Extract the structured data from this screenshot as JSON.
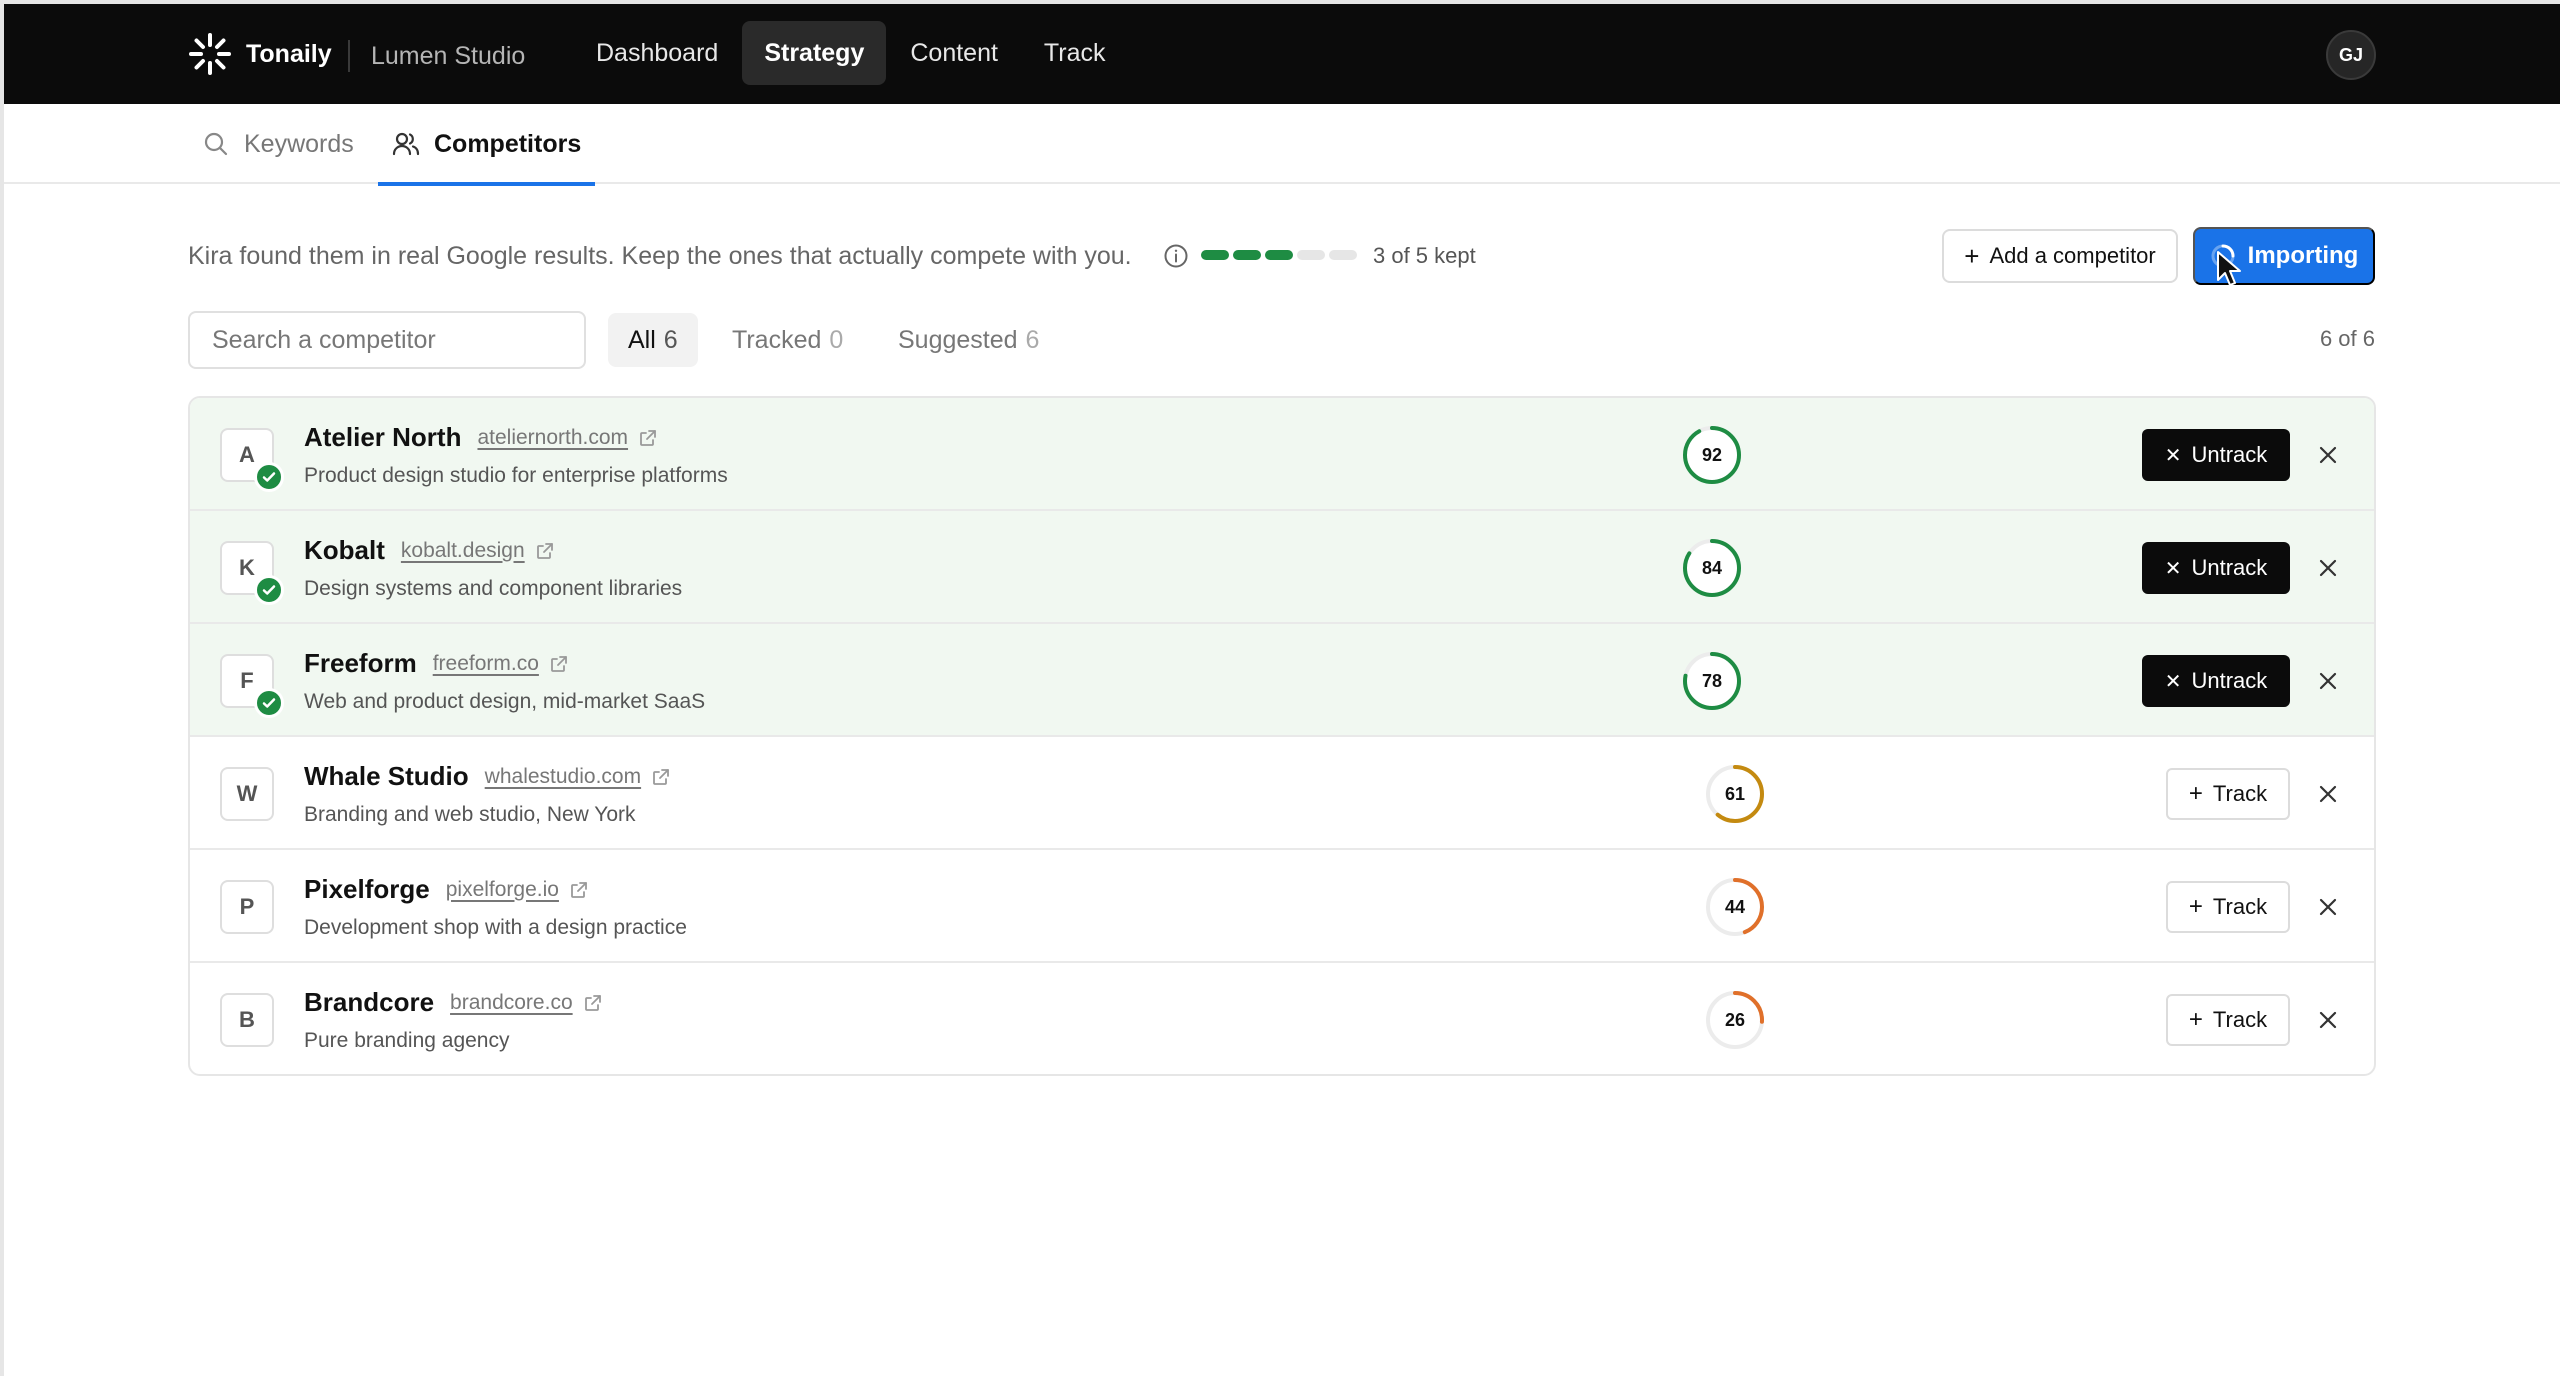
{
  "app": {
    "brand": "Tonaily",
    "workspace": "Lumen Studio",
    "avatar_initials": "GJ",
    "nav": [
      {
        "label": "Dashboard",
        "active": false
      },
      {
        "label": "Strategy",
        "active": true
      },
      {
        "label": "Content",
        "active": false
      },
      {
        "label": "Track",
        "active": false
      }
    ]
  },
  "subtabs": [
    {
      "label": "Keywords",
      "icon": "search-icon",
      "active": false
    },
    {
      "label": "Competitors",
      "icon": "users-icon",
      "active": true
    }
  ],
  "intro": {
    "text": "Kira found them in real Google results. Keep the ones that actually compete with you.",
    "kept_label": "3 of 5 kept",
    "kept": 3,
    "total": 5
  },
  "actions": {
    "add_label": "Add a competitor",
    "import_label": "Importing"
  },
  "filters": {
    "search_placeholder": "Search a competitor",
    "tabs": [
      {
        "label": "All",
        "count": "6",
        "active": true
      },
      {
        "label": "Tracked",
        "count": "0",
        "active": false
      },
      {
        "label": "Suggested",
        "count": "6",
        "active": false
      }
    ],
    "result_count": "6 of 6"
  },
  "labels": {
    "untrack": "Untrack",
    "track": "Track"
  },
  "colors": {
    "accent": "#1a73e8",
    "tracked_bg": "#f1f8f1",
    "green": "#1e8c43",
    "amber": "#c48a10",
    "orange": "#e0702a"
  },
  "competitors": [
    {
      "letter": "A",
      "name": "Atelier North",
      "domain": "ateliernorth.com",
      "description": "Product design studio for enterprise platforms",
      "score": 92,
      "tracked": true
    },
    {
      "letter": "K",
      "name": "Kobalt",
      "domain": "kobalt.design",
      "description": "Design systems and component libraries",
      "score": 84,
      "tracked": true
    },
    {
      "letter": "F",
      "name": "Freeform",
      "domain": "freeform.co",
      "description": "Web and product design, mid-market SaaS",
      "score": 78,
      "tracked": true
    },
    {
      "letter": "W",
      "name": "Whale Studio",
      "domain": "whalestudio.com",
      "description": "Branding and web studio, New York",
      "score": 61,
      "tracked": false
    },
    {
      "letter": "P",
      "name": "Pixelforge",
      "domain": "pixelforge.io",
      "description": "Development shop with a design practice",
      "score": 44,
      "tracked": false
    },
    {
      "letter": "B",
      "name": "Brandcore",
      "domain": "brandcore.co",
      "description": "Pure branding agency",
      "score": 26,
      "tracked": false
    }
  ]
}
